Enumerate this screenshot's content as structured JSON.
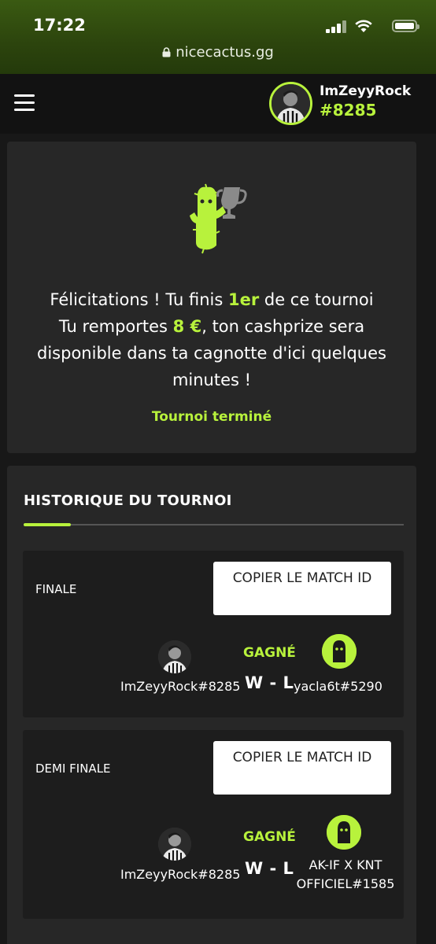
{
  "status_bar": {
    "time": "17:22",
    "url": "nicecactus.gg"
  },
  "header": {
    "username": "ImZeyyRock",
    "user_tag": "#8285"
  },
  "congrats": {
    "line1_prefix": "Félicitations ! Tu finis ",
    "place": "1er",
    "line1_suffix": " de ce tournoi",
    "line2_prefix": "Tu remportes ",
    "prize": "8 €",
    "line2_suffix": ", ton cashprize sera disponible dans ta cagnotte d'ici quelques minutes !",
    "status": "Tournoi terminé"
  },
  "history": {
    "title": "HISTORIQUE DU TOURNOI",
    "matches": [
      {
        "round": "FINALE",
        "copy_label": "COPIER LE MATCH ID",
        "player": "ImZeyyRock#8285",
        "result": "GAGNÉ",
        "score": "W - L",
        "opponent": "yacla6t#5290"
      },
      {
        "round": "DEMI FINALE",
        "copy_label": "COPIER LE MATCH ID",
        "player": "ImZeyyRock#8285",
        "result": "GAGNÉ",
        "score": "W - L",
        "opponent": "AK-IF X KNT OFFICIEL#1585"
      }
    ]
  },
  "colors": {
    "accent": "#b8f23c",
    "card": "#272727",
    "background": "#181818"
  }
}
